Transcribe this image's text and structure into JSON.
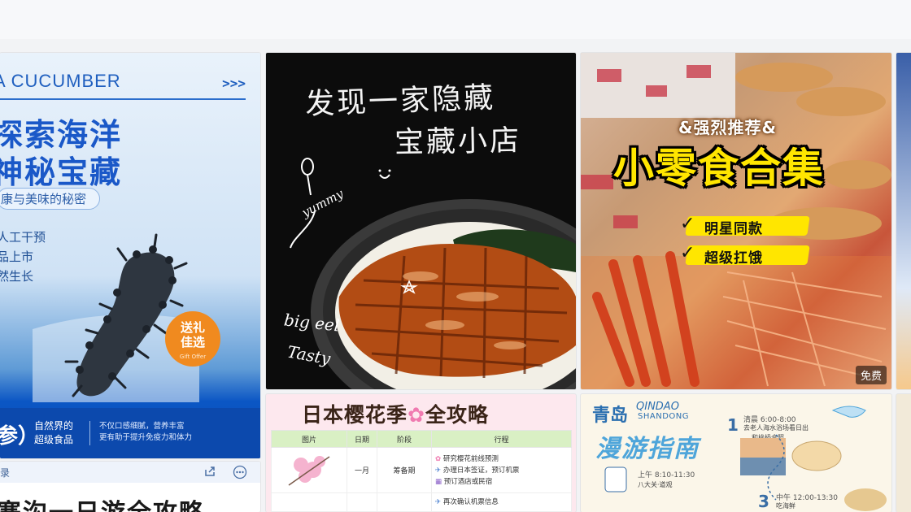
{
  "card_sea_cucumber": {
    "eng_title": "A CUCUMBER",
    "arrows": ">>>",
    "headline_line1": "探索海洋",
    "headline_line2": "神秘宝藏",
    "subtitle": "康与美味的秘密",
    "bullets": [
      "人工干预",
      "品上市",
      "然生长"
    ],
    "badge_line1": "送礼",
    "badge_line2": "佳选",
    "badge_small": "Gift Offer",
    "footer_big": "参）",
    "footer_mid_line1": "自然界的",
    "footer_mid_line2": "超级食品",
    "footer_small_line1": "不仅口感细腻，营养丰富",
    "footer_small_line2": "更有助于提升免疫力和体力",
    "colors": {
      "primary": "#1a58c8",
      "footer": "#0c49ad",
      "badge": "#f08a1f"
    }
  },
  "card_article": {
    "bar_label": "录",
    "title": "寨沟一日游全攻略",
    "share_icon": "share-icon",
    "more_icon": "more-icon"
  },
  "card_eel": {
    "headline_line1": "发现一家隐藏",
    "headline_line2": "宝藏小店",
    "yummy": "yummy",
    "bigeel": "big eel",
    "tasty": "Tasty"
  },
  "card_snacks": {
    "kicker": "&强烈推荐&",
    "title": "小零食合集",
    "checks": [
      "明星同款",
      "超级扛饿"
    ],
    "free_badge": "免费",
    "colors": {
      "title": "#ffe600"
    }
  },
  "card_sakura": {
    "title": "日本樱花季",
    "title_suffix": "全攻略",
    "headers": [
      "图片",
      "日期",
      "阶段",
      "行程"
    ],
    "rows": [
      {
        "date": "一月",
        "stage": "筹备期",
        "tasks": [
          "研究樱花前线预测",
          "办理日本签证，预订机票",
          "预订酒店或民宿"
        ]
      },
      {
        "date": "",
        "stage": "",
        "tasks": [
          "再次确认机票信息"
        ]
      }
    ]
  },
  "card_qingdao": {
    "cn": "青岛",
    "en1": "QINDAO",
    "en2": "SHANDONG",
    "guide": "漫游指南",
    "step1_num": "1",
    "step1_time": "清晨 6:00-8:00",
    "step1_note_line1": "去老人海水浴场看日出",
    "step1_note_line2": "和栈桥合照",
    "step2_time": "上午 8:10-11:30",
    "step2_note": "八大关·道观",
    "step3_num": "3",
    "step3_time": "中午 12:00-13:30",
    "step3_note": "吃海鲜"
  }
}
